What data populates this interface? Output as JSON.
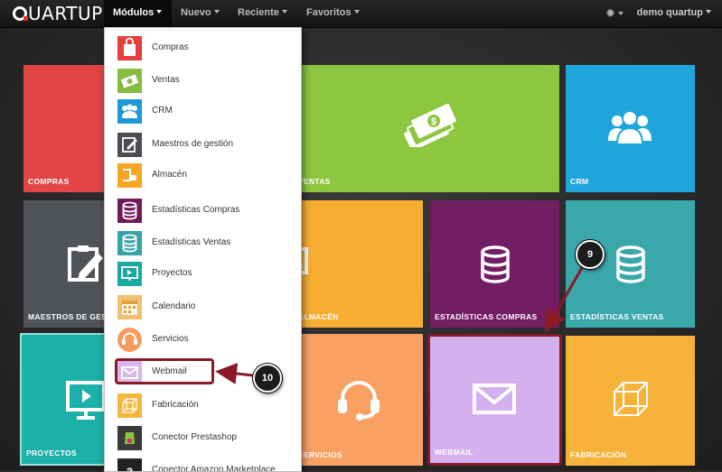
{
  "navbar": {
    "logo": "UARTUP",
    "menus": [
      {
        "label": "Módulos"
      },
      {
        "label": "Nuevo"
      },
      {
        "label": "Reciente"
      },
      {
        "label": "Favoritos"
      }
    ],
    "user": "demo quartup"
  },
  "dropdown": {
    "items": [
      {
        "label": "Compras",
        "color": "#e53f3f"
      },
      {
        "label": "Ventas",
        "color": "#86bd3e"
      },
      {
        "label": "CRM",
        "color": "#1d9ad6"
      },
      {
        "label": "Maestros de gestión",
        "color": "#4a4d52"
      },
      {
        "label": "Almacén",
        "color": "#f5a623"
      },
      {
        "label": "Estadísticas Compras",
        "color": "#6e1a5c"
      },
      {
        "label": "Estadísticas Ventas",
        "color": "#36a3a7"
      },
      {
        "label": "Proyectos",
        "color": "#1aa8a0"
      },
      {
        "label": "Calendario",
        "color": "#f0c070"
      },
      {
        "label": "Servicios",
        "color": "#f69a60"
      },
      {
        "label": "Webmail",
        "color": "#d8b8ec"
      },
      {
        "label": "Fabricación",
        "color": "#f5b83f"
      },
      {
        "label": "Conector Prestashop",
        "color": "#3a3a3a"
      },
      {
        "label": "Conector Amazon Marketplace",
        "color": "#222222"
      }
    ]
  },
  "tiles": [
    {
      "label": "COMPRAS",
      "color": "#e34545"
    },
    {
      "label": "VENTAS",
      "color": "#8dc63f"
    },
    {
      "label": "CRM",
      "color": "#1fa5dc"
    },
    {
      "label": "MAESTROS DE GESTIÓN",
      "color": "#505358"
    },
    {
      "label": "ALMACÉN",
      "color": "#f7ae33"
    },
    {
      "label": "ESTADÍSTICAS COMPRAS",
      "color": "#731d63"
    },
    {
      "label": "ESTADÍSTICAS VENTAS",
      "color": "#3aa7ab"
    },
    {
      "label": "PROYECTOS",
      "color": "#1bb0a8"
    },
    {
      "label": "SERVICIOS",
      "color": "#f9a063"
    },
    {
      "label": "WEBMAIL",
      "color": "#d4b0ee"
    },
    {
      "label": "FABRICACIÓN",
      "color": "#f7b23a"
    }
  ],
  "annotations": {
    "step_9": "9",
    "step_10": "10",
    "color": "#8a1a26"
  }
}
